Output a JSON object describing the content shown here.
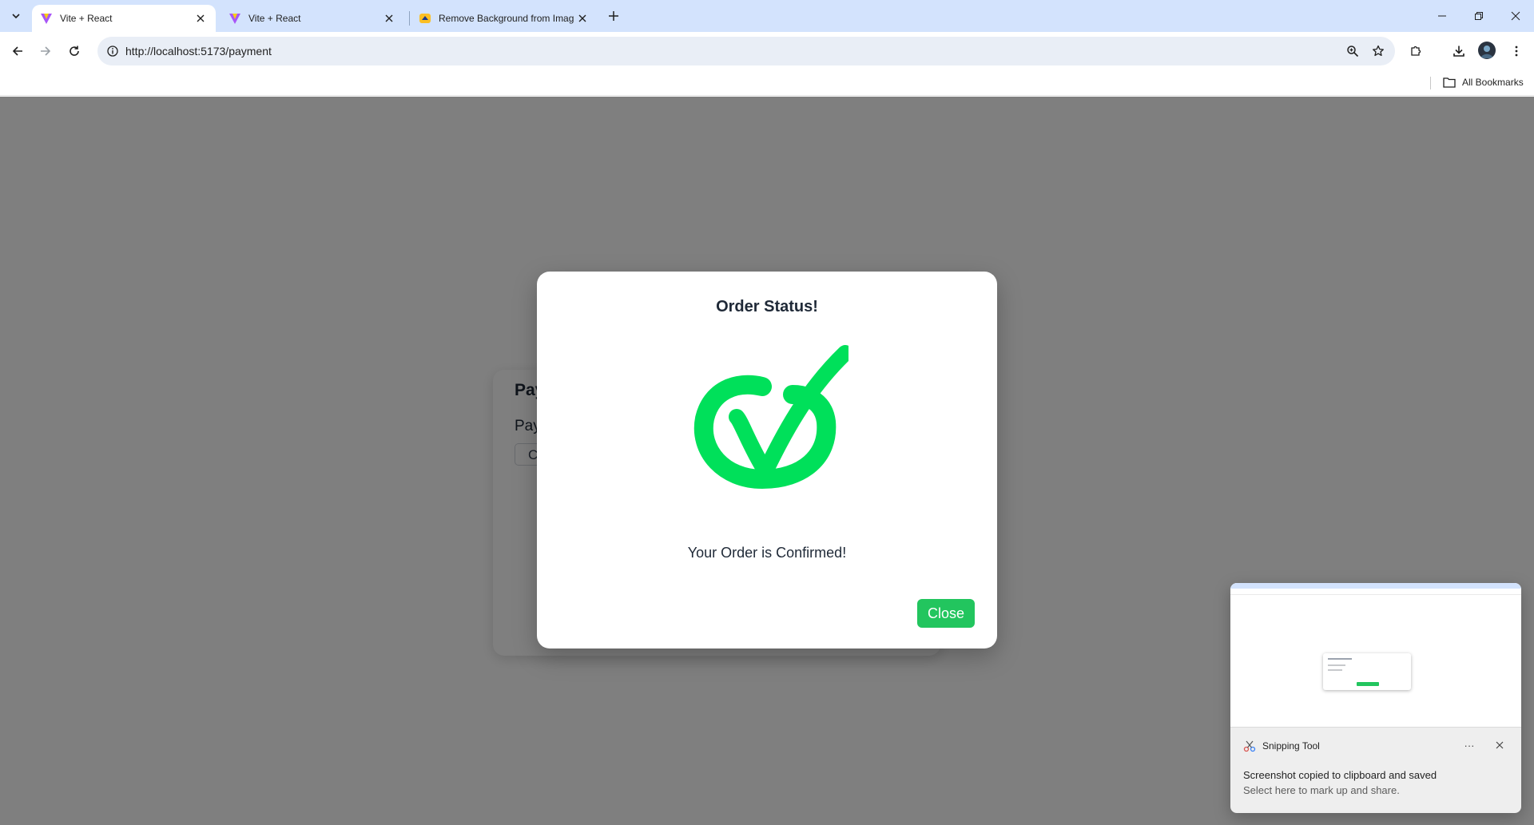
{
  "browser": {
    "tabs": [
      {
        "title": "Vite + React",
        "icon": "vite-logo-icon",
        "active": true
      },
      {
        "title": "Vite + React",
        "icon": "vite-logo-icon",
        "active": false
      },
      {
        "title": "Remove Background from Imag",
        "icon": "remove-bg-icon",
        "active": false
      }
    ],
    "url": "http://localhost:5173/payment",
    "bookmarks_label": "All Bookmarks"
  },
  "page": {
    "background_title": "Pay",
    "background_label": "Pay",
    "background_select": "C"
  },
  "modal": {
    "title": "Order Status!",
    "message": "Your Order is Confirmed!",
    "close_label": "Close",
    "accent_color": "#22c55e",
    "check_color": "#00e05a"
  },
  "notification": {
    "app_name": "Snipping Tool",
    "line1": "Screenshot copied to clipboard and saved",
    "line2": "Select here to mark up and share.",
    "more_label": "···"
  }
}
